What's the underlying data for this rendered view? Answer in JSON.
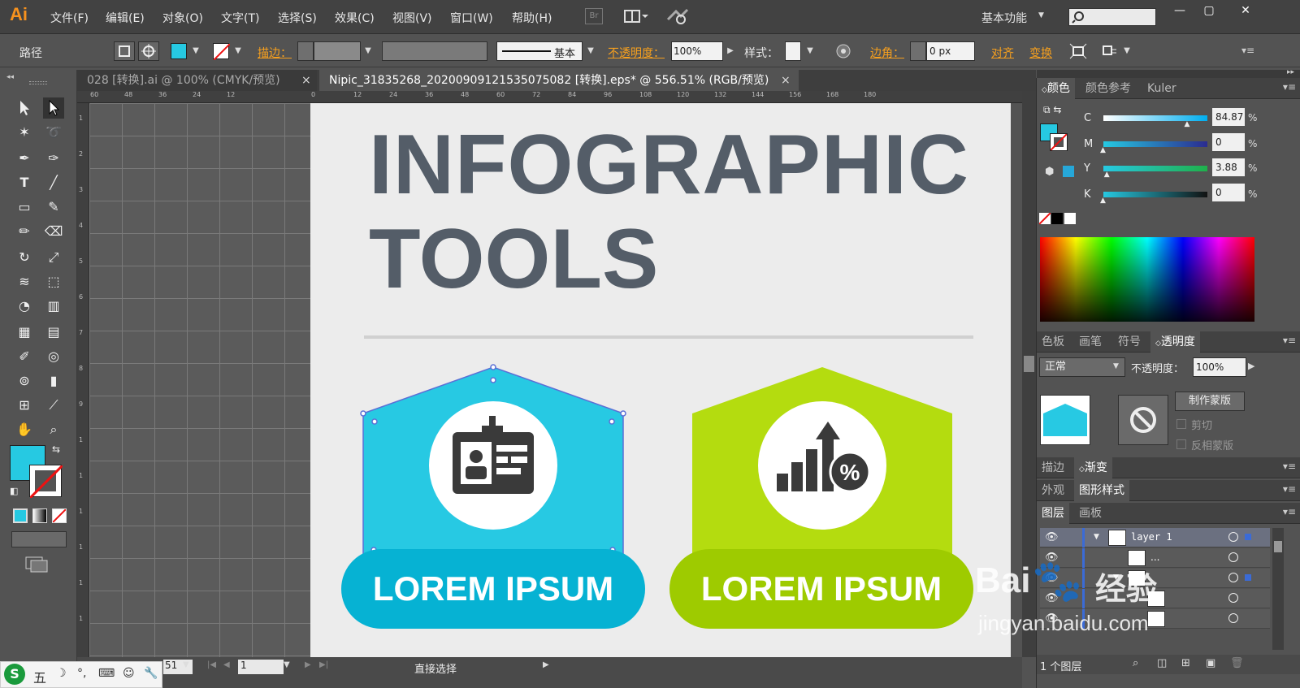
{
  "app": {
    "logo": "Ai",
    "menus": [
      "文件(F)",
      "编辑(E)",
      "对象(O)",
      "文字(T)",
      "选择(S)",
      "效果(C)",
      "视图(V)",
      "窗口(W)",
      "帮助(H)"
    ],
    "bridge_label": "Br",
    "workspace": "基本功能",
    "search_placeholder": "",
    "window_buttons": [
      "—",
      "▢",
      "✕"
    ]
  },
  "control_bar": {
    "selection_type": "路径",
    "stroke_label": "描边：",
    "stroke_style": "基本",
    "opacity_label": "不透明度：",
    "opacity_value": "100%",
    "style_label": "样式：",
    "corner_label": "边角：",
    "corner_value": "0 px",
    "align_label": "对齐",
    "transform_label": "变换",
    "fill_color": "#26c9e2"
  },
  "documents": [
    {
      "label": "028 [转换].ai @ 100% (CMYK/预览)",
      "close": "×",
      "active": false
    },
    {
      "label": "Nipic_31835268_20200909121535075082 [转换].eps* @ 556.51% (RGB/预览)",
      "close": "×",
      "active": true
    }
  ],
  "ruler_top": [
    "60",
    "48",
    "36",
    "24",
    "12",
    "0",
    "12",
    "24",
    "36",
    "48",
    "60",
    "72",
    "84",
    "96",
    "108",
    "120",
    "132",
    "144",
    "156",
    "168",
    "180"
  ],
  "ruler_left": [
    "1",
    "2",
    "3",
    "4",
    "5",
    "6",
    "7",
    "8",
    "9",
    "1",
    "1",
    "1",
    "1",
    "1",
    "1"
  ],
  "artboard": {
    "title_line1": "INFOGRAPHIC",
    "title_line2": "TOOLS",
    "card1": {
      "label": "LOREM IPSUM",
      "color": "#27c9e3",
      "pill_color": "#06b2d3"
    },
    "card2": {
      "label": "LOREM IPSUM",
      "color": "#b4dc0f",
      "pill_color": "#9ecb00"
    },
    "title_color": "#545d68"
  },
  "statusbar": {
    "zoom": "51",
    "page": "1",
    "tool_name": "直接选择"
  },
  "panels": {
    "color_tabs": [
      "颜色",
      "颜色参考",
      "Kuler"
    ],
    "cmyk": [
      {
        "label": "C",
        "value": "84.87",
        "fraction": 0.8487
      },
      {
        "label": "M",
        "value": "0",
        "fraction": 0
      },
      {
        "label": "Y",
        "value": "3.88",
        "fraction": 0.0388
      },
      {
        "label": "K",
        "value": "0",
        "fraction": 0
      }
    ],
    "percent": "%",
    "swatch_tabs": [
      "色板",
      "画笔",
      "符号",
      "透明度"
    ],
    "blend_mode": "正常",
    "transparency_opacity_label": "不透明度：",
    "transparency_opacity_value": "100%",
    "make_mask": "制作蒙版",
    "clip": "剪切",
    "invert_mask": "反相蒙版",
    "stroke_tabs": [
      "描边",
      "渐变"
    ],
    "appearance_tabs": [
      "外观",
      "图形样式"
    ],
    "layer_tabs": [
      "图层",
      "画板"
    ],
    "layers": [
      {
        "name": "layer 1"
      },
      {
        "name": "..."
      },
      {
        "name": ""
      },
      {
        "name": ""
      },
      {
        "name": ""
      }
    ],
    "layer_count": "1 个图层"
  },
  "ime": {
    "mode": "五"
  },
  "watermark": {
    "brand": "Bai",
    "brand2": "经验",
    "url": "jingyan.baidu.com"
  }
}
